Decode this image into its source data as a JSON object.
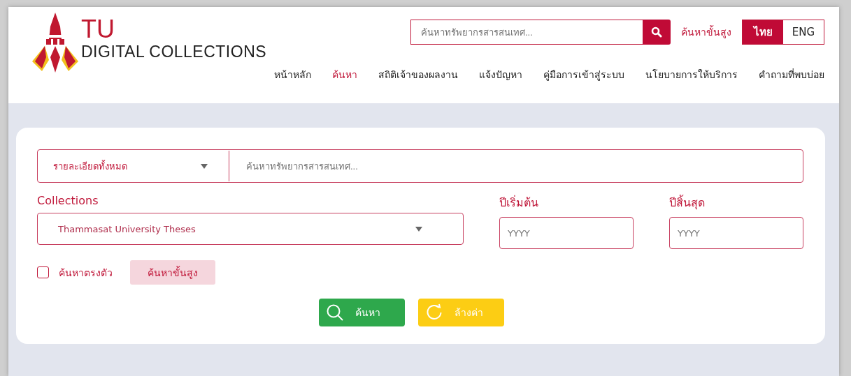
{
  "header": {
    "logo": {
      "mark": "TU",
      "name": "DIGITAL COLLECTIONS"
    },
    "search": {
      "placeholder": "ค้นหาทรัพยากรสารสนเทศ..."
    },
    "advanced_link": "ค้นหาขั้นสูง",
    "languages": [
      {
        "label": "ไทย",
        "selected": true
      },
      {
        "label": "ENG",
        "selected": false
      }
    ]
  },
  "nav": [
    {
      "label": "หน้าหลัก",
      "selected": false
    },
    {
      "label": "ค้นหา",
      "selected": true
    },
    {
      "label": "สถิติเจ้าของผลงาน",
      "selected": false
    },
    {
      "label": "แจ้งปัญหา",
      "selected": false
    },
    {
      "label": "คู่มือการเข้าสู่ระบบ",
      "selected": false
    },
    {
      "label": "นโยบายการให้บริการ",
      "selected": false
    },
    {
      "label": "คำถามที่พบบ่อย",
      "selected": false
    }
  ],
  "search_form": {
    "field_select": "รายละเอียดทั้งหมด",
    "query": {
      "placeholder": "ค้นหาทรัพยากรสารสนเทศ..."
    },
    "collections": {
      "label": "Collections",
      "value": "Thammasat University Theses"
    },
    "start_year": {
      "label": "ปีเริ่มต้น",
      "placeholder": "YYYY"
    },
    "end_year": {
      "label": "ปีสิ้นสุด",
      "placeholder": "YYYY"
    },
    "exact": {
      "label": "ค้นหาตรงตัว",
      "checked": false
    },
    "advanced_button": "ค้นหาขั้นสูง",
    "buttons": [
      {
        "kind": "search",
        "label": "ค้นหา"
      },
      {
        "kind": "reset",
        "label": "ล้างค่า"
      }
    ]
  }
}
